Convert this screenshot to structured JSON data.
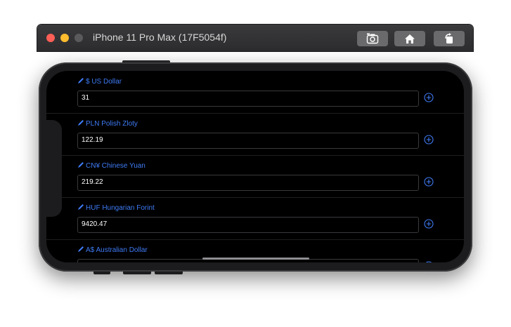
{
  "window": {
    "title": "iPhone 11 Pro Max (17F5054f)",
    "toolbar": {
      "screenshot_icon": "camera-screenshot-icon",
      "home_icon": "home-icon",
      "rotate_icon": "rotate-icon"
    }
  },
  "colors": {
    "accent": "#3f7bf5",
    "screen_bg": "#000000",
    "field_border": "#3a3a3c",
    "close": "#ff5f57",
    "minimize": "#febc2e"
  },
  "currencies": [
    {
      "label": "$ US Dollar",
      "value": "31"
    },
    {
      "label": "PLN Polish Zloty",
      "value": "122.19"
    },
    {
      "label": "CN¥ Chinese Yuan",
      "value": "219.22"
    },
    {
      "label": "HUF Hungarian Forint",
      "value": "9420.47"
    },
    {
      "label": "A$ Australian Dollar",
      "value": ""
    }
  ]
}
